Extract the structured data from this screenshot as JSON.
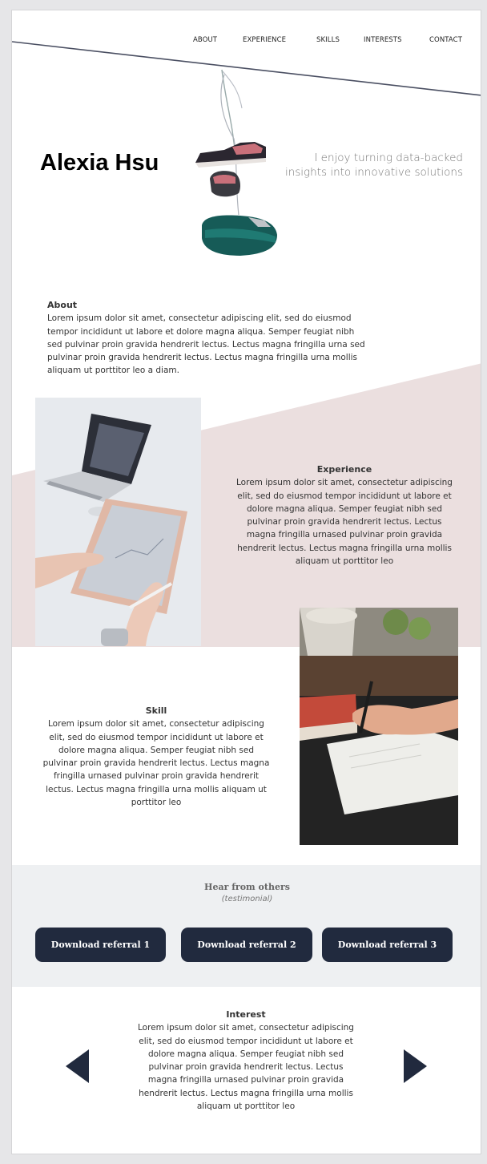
{
  "nav": {
    "about": "ABOUT",
    "experience": "EXPERIENCE",
    "skills": "SKILLS",
    "interests": "INTERESTS",
    "contact": "CONTACT"
  },
  "hero": {
    "name": "Alexia Hsu",
    "tagline": "I enjoy turning data-backed insights into innovative solutions"
  },
  "about": {
    "title": "About",
    "text": "Lorem ipsum dolor sit amet, consectetur adipiscing elit, sed do eiusmod tempor incididunt ut labore et dolore magna aliqua. Semper feugiat nibh sed pulvinar proin gravida hendrerit lectus. Lectus magna fringilla urna sed pulvinar proin gravida hendrerit lectus. Lectus magna fringilla urna mollis aliquam ut porttitor leo a diam."
  },
  "experience": {
    "title": "Experience",
    "text": "Lorem ipsum dolor sit amet, consectetur adipiscing elit, sed do eiusmod tempor incididunt ut labore et dolore magna aliqua. Semper feugiat nibh sed pulvinar proin gravida hendrerit lectus. Lectus magna fringilla urnased pulvinar proin gravida hendrerit lectus. Lectus magna fringilla urna mollis aliquam ut porttitor leo"
  },
  "skill": {
    "title": "Skill",
    "text": "Lorem ipsum dolor sit amet, consectetur adipiscing elit, sed do eiusmod tempor incididunt ut labore et dolore magna aliqua. Semper feugiat nibh sed pulvinar proin gravida hendrerit lectus. Lectus magna fringilla urnased pulvinar proin gravida hendrerit lectus. Lectus magna fringilla urna mollis aliquam ut porttitor leo"
  },
  "testimonial": {
    "title": "Hear from others",
    "subtitle": "(testimonial)",
    "buttons": [
      "Download referral 1",
      "Download referral 2",
      "Download referral 3"
    ]
  },
  "interest": {
    "title": "Interest",
    "text": "Lorem ipsum dolor sit amet, consectetur adipiscing elit, sed do eiusmod tempor incididunt ut labore et dolore magna aliqua. Semper feugiat nibh sed pulvinar proin gravida hendrerit lectus. Lectus magna fringilla urnased pulvinar proin gravida hendrerit lectus. Lectus magna fringilla urna mollis aliquam ut porttitor leo"
  },
  "colors": {
    "accent_dark": "#212a3e",
    "slant_pink": "#ebdfdf",
    "band_grey": "#eef0f2"
  },
  "icons": {
    "prev": "triangle-left-icon",
    "next": "triangle-right-icon"
  }
}
